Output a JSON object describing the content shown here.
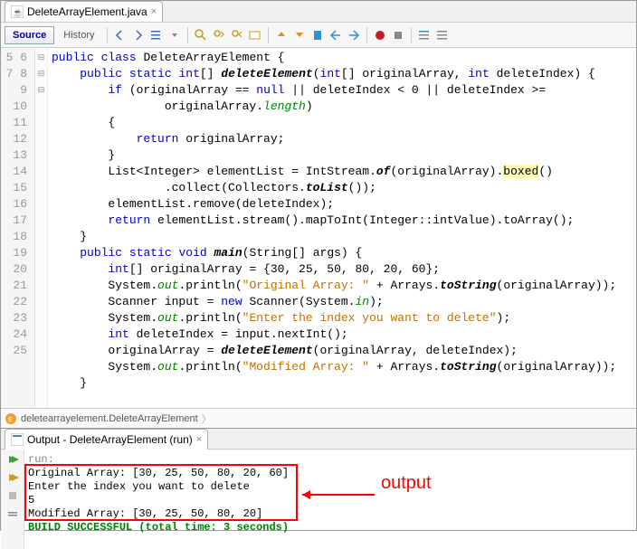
{
  "file_tab": {
    "name": "DeleteArrayElement.java"
  },
  "toolbar": {
    "source": "Source",
    "history": "History"
  },
  "gutter_start": 5,
  "gutter_end": 25,
  "code_lines": [
    {
      "raw": "<span class='kw'>public</span> <span class='kw'>class</span> DeleteArrayElement {"
    },
    {
      "raw": "    <span class='kw'>public</span> <span class='kw'>static</span> <span class='kw'>int</span>[] <span class='mth'>deleteElement</span>(<span class='kw'>int</span>[] originalArray, <span class='kw'>int</span> deleteIndex) {"
    },
    {
      "raw": "        <span class='kw'>if</span> (originalArray == <span class='kw'>null</span> || deleteIndex &lt; 0 || deleteIndex &gt;="
    },
    {
      "raw": "                originalArray.<span class='fld'>length</span>)"
    },
    {
      "raw": "        {"
    },
    {
      "raw": "            <span class='kw'>return</span> originalArray;"
    },
    {
      "raw": "        }"
    },
    {
      "raw": "        List&lt;Integer&gt; elementList = IntStream.<span class='mth'>of</span>(originalArray).<span class='hl'>boxed</span>()"
    },
    {
      "raw": "                .collect(Collectors.<span class='mth'>toList</span>());"
    },
    {
      "raw": "        elementList.remove(deleteIndex);"
    },
    {
      "raw": "        <span class='kw'>return</span> elementList.stream().mapToInt(Integer::intValue).toArray();"
    },
    {
      "raw": "    }"
    },
    {
      "raw": "    <span class='kw'>public</span> <span class='kw'>static</span> <span class='kw'>void</span> <span class='mth'>main</span>(String[] args) {"
    },
    {
      "raw": "        <span class='kw'>int</span>[] originalArray = {30, 25, 50, 80, 20, 60};"
    },
    {
      "raw": "        System.<span class='fld'>out</span>.println(<span class='str'>\"Original Array: \"</span> + Arrays.<span class='mth'>toString</span>(originalArray));"
    },
    {
      "raw": "        Scanner input = <span class='kw'>new</span> Scanner(System.<span class='fld'>in</span>);"
    },
    {
      "raw": "        System.<span class='fld'>out</span>.println(<span class='str'>\"Enter the index you want to delete\"</span>);"
    },
    {
      "raw": "        <span class='kw'>int</span> deleteIndex = input.nextInt();"
    },
    {
      "raw": "        originalArray = <span class='mth'>deleteElement</span>(originalArray, deleteIndex);"
    },
    {
      "raw": "        System.<span class='fld'>out</span>.println(<span class='str'>\"Modified Array: \"</span> + Arrays.<span class='mth'>toString</span>(originalArray));"
    },
    {
      "raw": "    }"
    }
  ],
  "fold_marks": {
    "0": "⊟",
    "1": "⊟",
    "12": "⊟"
  },
  "breadcrumb": "deletearrayelement.DeleteArrayElement",
  "output_tab": "Output - DeleteArrayElement (run)",
  "output_lines": {
    "run": "run:",
    "l1": "Original Array: [30, 25, 50, 80, 20, 60]",
    "l2": "Enter the index you want to delete",
    "l3": "5",
    "l4": "Modified Array: [30, 25, 50, 80, 20]",
    "build": "BUILD SUCCESSFUL (total time: 3 seconds)"
  },
  "annotation_label": "output"
}
